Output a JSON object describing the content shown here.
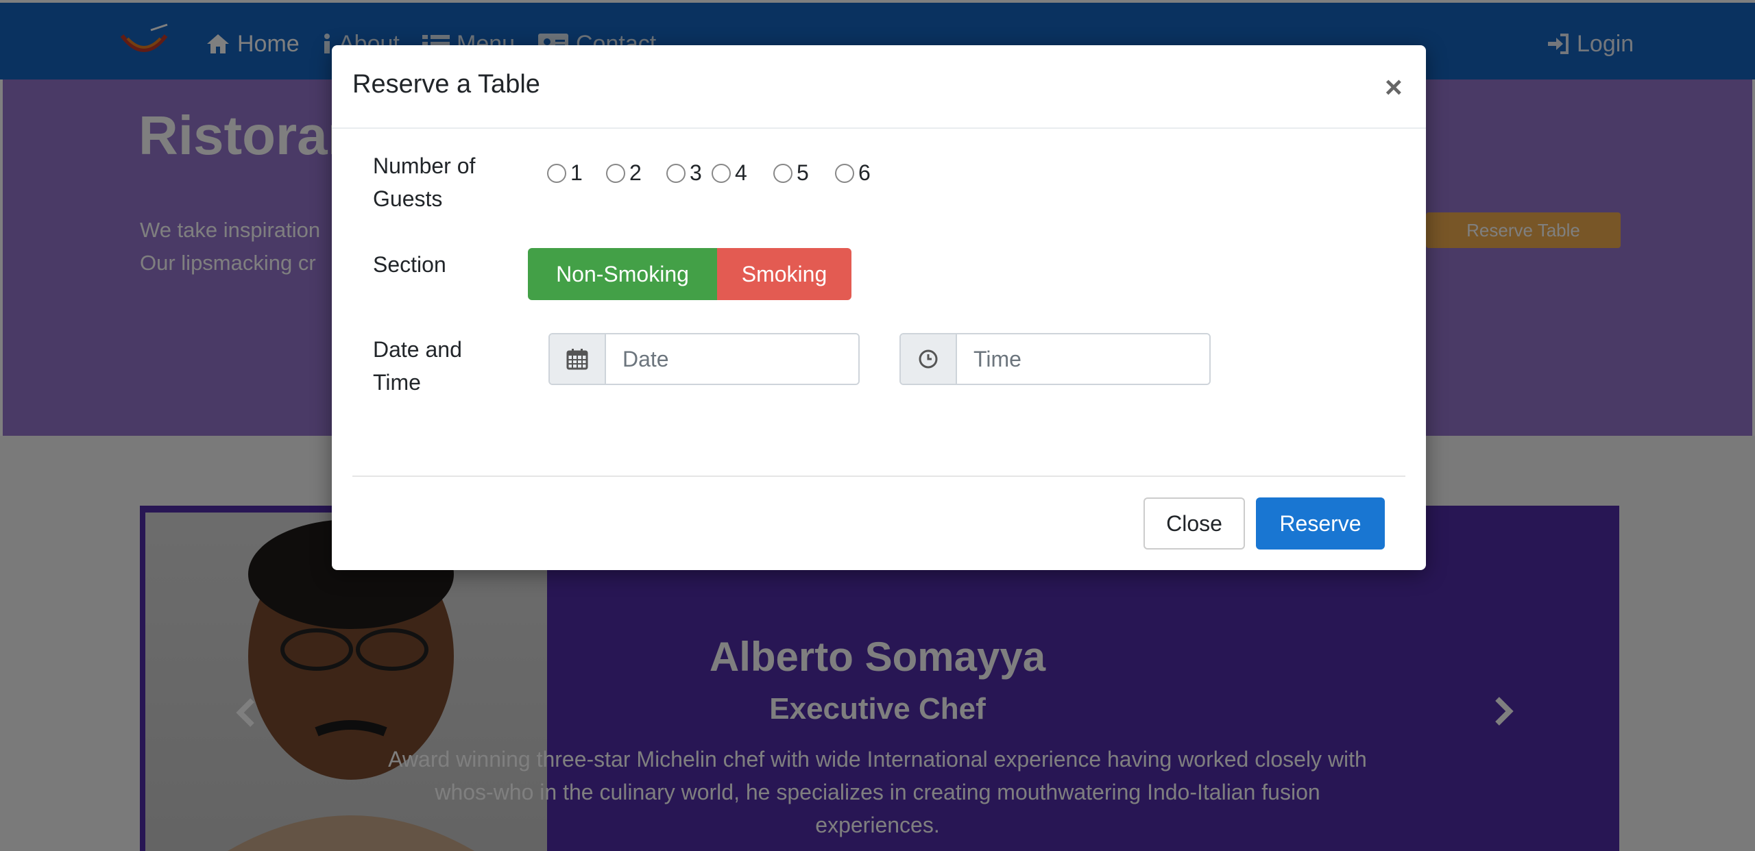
{
  "navbar": {
    "home": "Home",
    "about": "About",
    "menu": "Menu",
    "contact": "Contact",
    "login": "Login"
  },
  "jumbotron": {
    "title": "Ristoran",
    "text_line1": "We take inspiration",
    "text_line2": "Our lipsmacking cr",
    "reserve_button": "Reserve Table"
  },
  "carousel": {
    "name": "Alberto Somayya",
    "title": "Executive Chef",
    "description": "Award winning three-star Michelin chef with wide International experience having worked closely with whos-who in the culinary world, he specializes in creating mouthwatering Indo-Italian fusion experiences."
  },
  "modal": {
    "title": "Reserve a Table",
    "close_symbol": "×",
    "guests_label": "Number of Guests",
    "guest_options": [
      "1",
      "2",
      "3",
      "4",
      "5",
      "6"
    ],
    "section_label": "Section",
    "section_options": [
      "Non-Smoking",
      "Smoking"
    ],
    "datetime_label": "Date and Time",
    "date_placeholder": "Date",
    "time_placeholder": "Time",
    "close_button": "Close",
    "reserve_button": "Reserve"
  },
  "colors": {
    "navbar": "#1565c0",
    "jumbotron": "#9575cd",
    "carousel": "#512da8",
    "non_smoking": "#43a047",
    "smoking": "#e35b52",
    "reserve_primary": "#1976d2",
    "reserve_table": "#f0ad4e"
  }
}
